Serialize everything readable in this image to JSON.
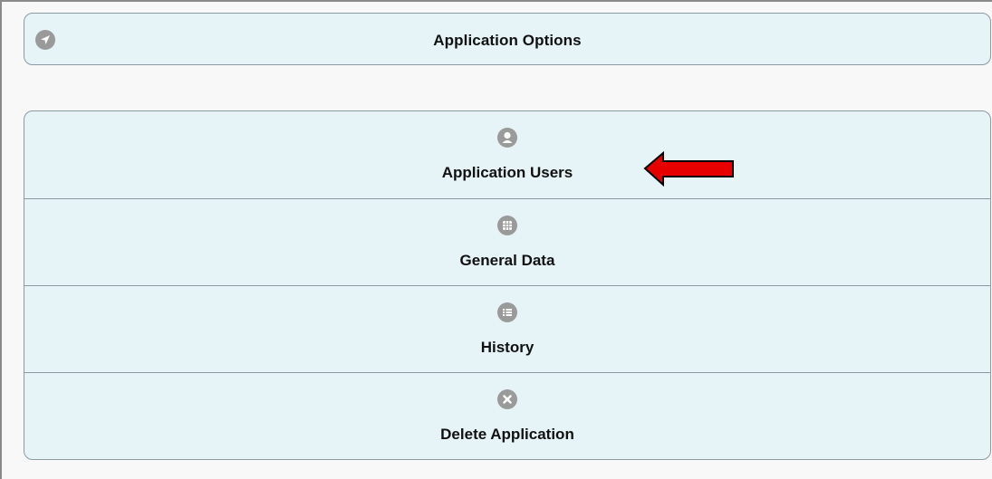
{
  "header": {
    "title": "Application Options",
    "icon": "navigate-arrow-icon"
  },
  "menu": {
    "items": [
      {
        "label": "Application Users",
        "icon": "user-icon"
      },
      {
        "label": "General Data",
        "icon": "grid-icon"
      },
      {
        "label": "History",
        "icon": "list-icon"
      },
      {
        "label": "Delete Application",
        "icon": "delete-x-icon"
      }
    ]
  },
  "annotation": {
    "pointer": "red-arrow-pointing-left",
    "color": "#e60000"
  },
  "colors": {
    "panel_bg": "#e6f4f8",
    "border": "#8c9aa1",
    "icon_gray": "#9a9a9a",
    "text": "#111111"
  }
}
